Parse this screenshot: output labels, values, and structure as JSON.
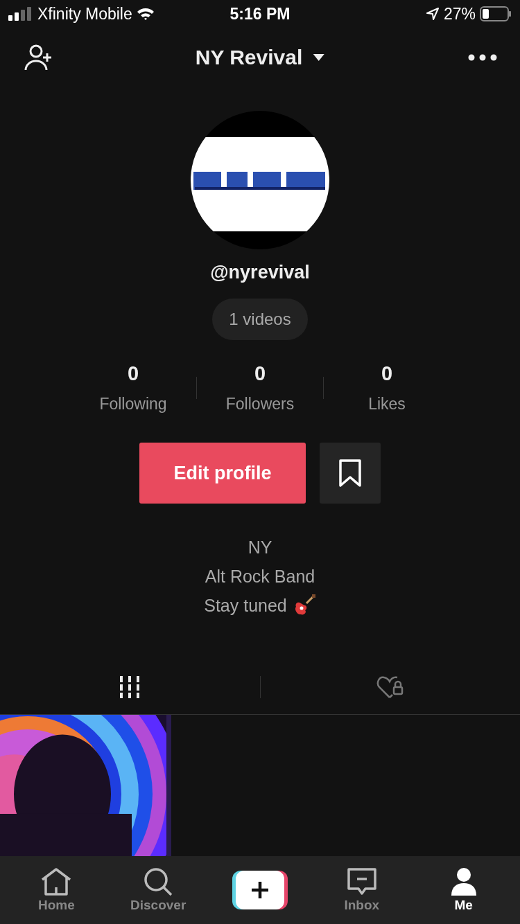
{
  "status_bar": {
    "carrier": "Xfinity Mobile",
    "time": "5:16 PM",
    "battery": "27%"
  },
  "header": {
    "title": "NY Revival"
  },
  "profile": {
    "username": "@nyrevival",
    "videos_count": "1 videos"
  },
  "stats": [
    {
      "value": "0",
      "label": "Following"
    },
    {
      "value": "0",
      "label": "Followers"
    },
    {
      "value": "0",
      "label": "Likes"
    }
  ],
  "edit_button": "Edit profile",
  "bio": [
    "NY",
    "Alt Rock Band",
    "Stay tuned"
  ],
  "tabs": [
    {
      "kind": "videos",
      "selected": true
    },
    {
      "kind": "liked",
      "selected": false
    }
  ],
  "nav": [
    {
      "kind": "home",
      "label": "Home",
      "selected": false
    },
    {
      "kind": "discover",
      "label": "Discover",
      "selected": false
    },
    {
      "kind": "create"
    },
    {
      "kind": "inbox",
      "label": "Inbox",
      "selected": false
    },
    {
      "kind": "me",
      "label": "Me",
      "selected": true
    }
  ]
}
